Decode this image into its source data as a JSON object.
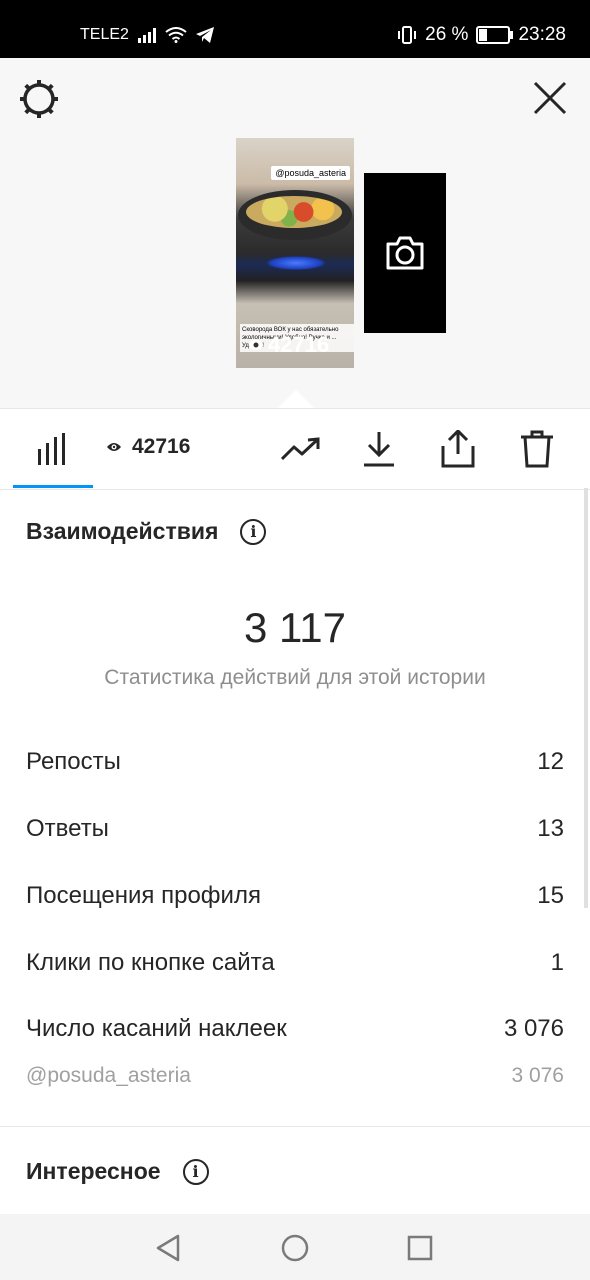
{
  "status_bar": {
    "carrier": "TELE2",
    "battery_percent": "26 %",
    "battery_level": 0.26,
    "time": "23:28"
  },
  "story": {
    "tag": "@posuda_asteria",
    "caption": "Сковорода ВОК у нас обязательно экологичными! Удобно! Ручка и ... Удобно!",
    "views_overlay": "42716"
  },
  "tabs": {
    "views": "42716"
  },
  "interactions": {
    "title": "Взаимодействия",
    "total": "3 117",
    "caption": "Статистика действий для этой истории",
    "rows": [
      {
        "label": "Репосты",
        "value": "12"
      },
      {
        "label": "Ответы",
        "value": "13"
      },
      {
        "label": "Посещения профиля",
        "value": "15"
      },
      {
        "label": "Клики по кнопке сайта",
        "value": "1"
      },
      {
        "label": "Число касаний наклеек",
        "value": "3 076"
      }
    ],
    "sub_row": {
      "label": "@posuda_asteria",
      "value": "3 076"
    }
  },
  "interesting": {
    "title": "Интересное"
  },
  "colors": {
    "accent": "#0095f6",
    "muted": "#8e8e8e"
  }
}
